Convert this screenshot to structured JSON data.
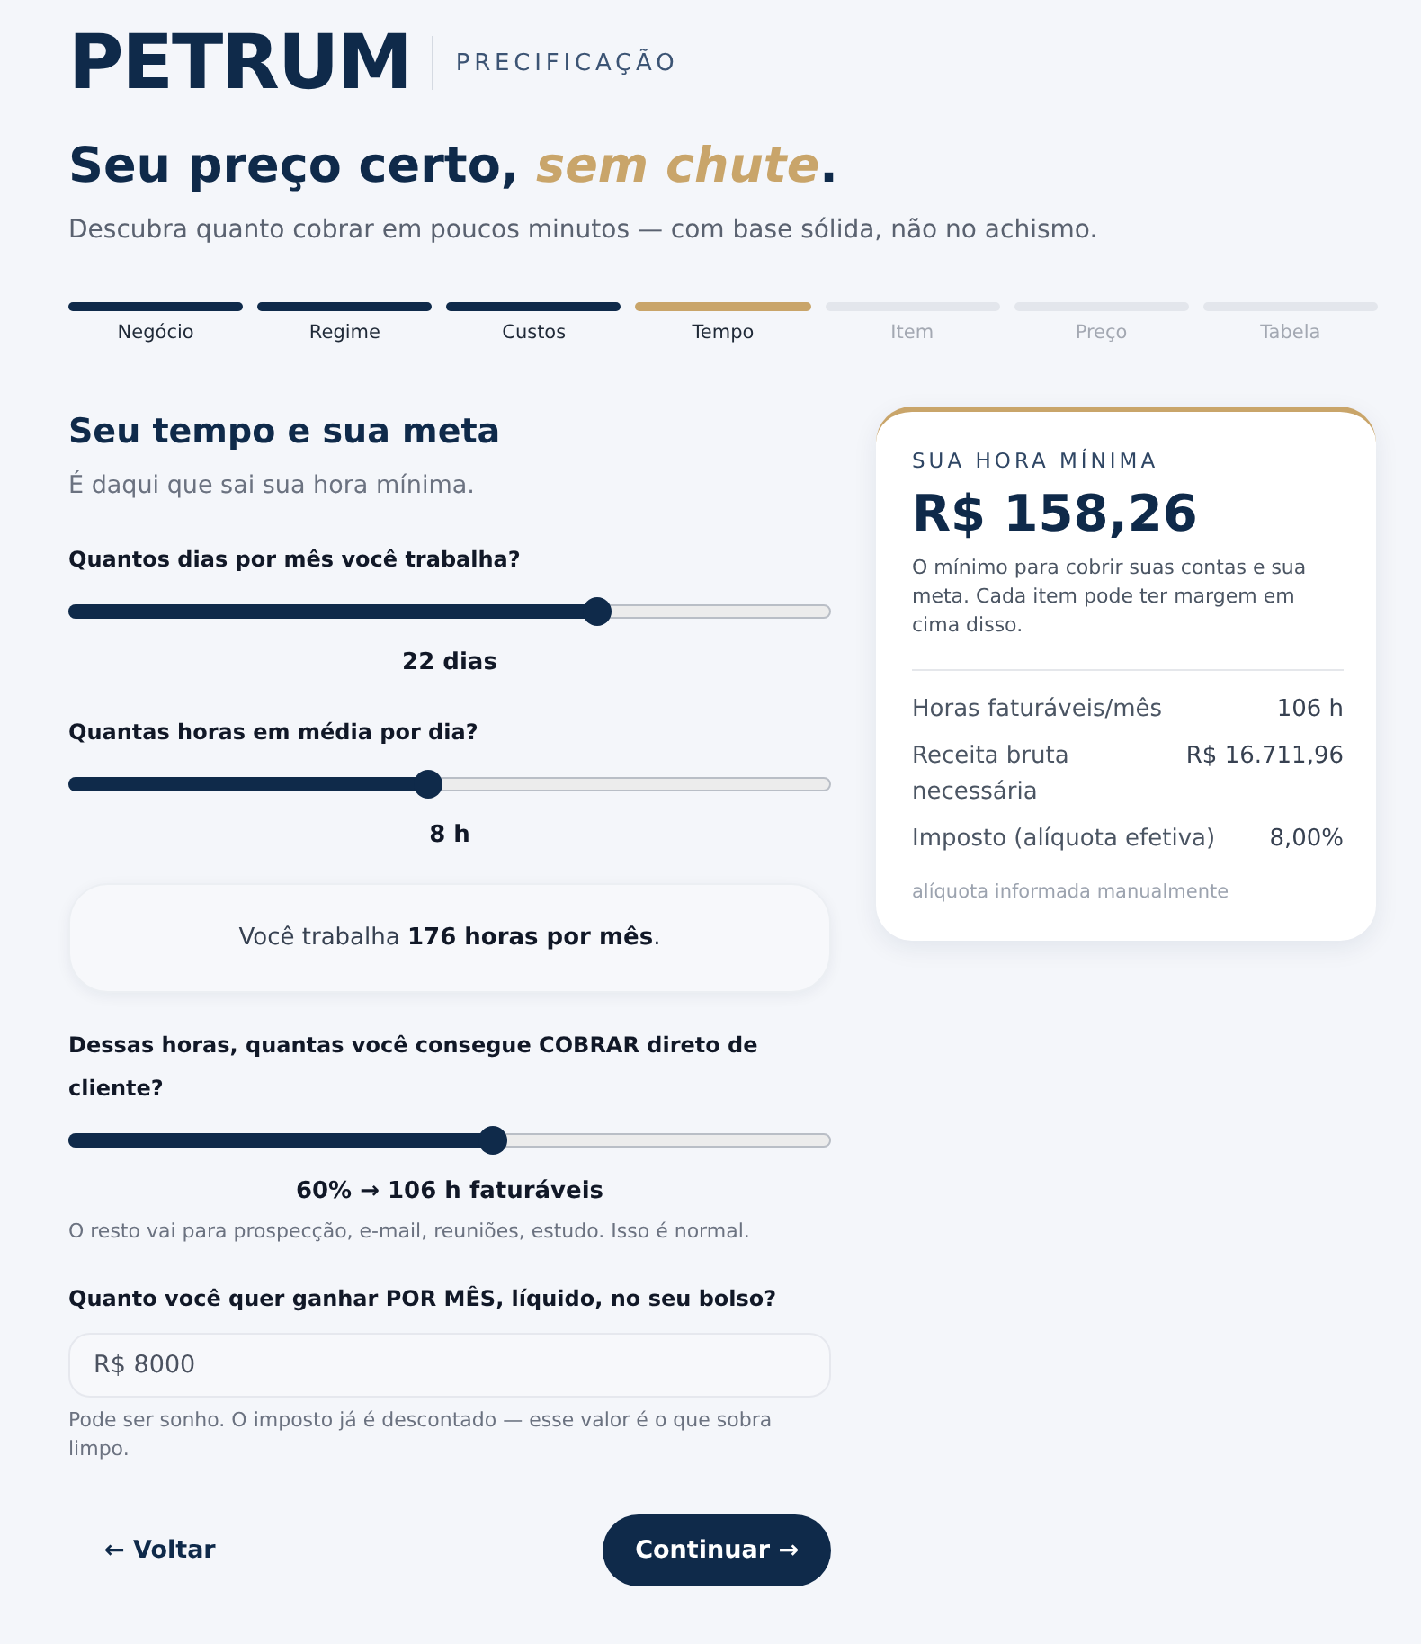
{
  "brand": {
    "logo": "PETRUM",
    "section": "PRECIFICAÇÃO"
  },
  "hero": {
    "title": "Seu preço certo, *sem chute*.",
    "subtitle": "Descubra quanto cobrar em poucos minutos — com base sólida, não no achismo."
  },
  "steps": [
    {
      "label": "Negócio",
      "done": true,
      "selected": false
    },
    {
      "label": "Regime",
      "done": true,
      "selected": false
    },
    {
      "label": "Custos",
      "done": true,
      "selected": false
    },
    {
      "label": "Tempo",
      "done": false,
      "selected": true
    },
    {
      "label": "Item",
      "done": false,
      "selected": false
    },
    {
      "label": "Preço",
      "done": false,
      "selected": false
    },
    {
      "label": "Tabela",
      "done": false,
      "selected": false
    }
  ],
  "form": {
    "title": "Seu tempo e sua meta",
    "subtitle": "É daqui que sai sua hora mínima.",
    "fields": [
      {
        "kind": "slider",
        "label": "Quantos dias por mês você trabalha?",
        "level": 0.7,
        "reading": "22 dias"
      },
      {
        "kind": "slider",
        "label": "Quantas horas em média por dia?",
        "level": 0.47,
        "reading": "8 h"
      },
      {
        "kind": "summary",
        "text": "Você trabalha **176 horas por mês**."
      },
      {
        "kind": "slider",
        "label": "Dessas horas, quantas você consegue COBRAR direto de cliente?",
        "level": 0.56,
        "reading": "60% → 106 h faturáveis",
        "hint": "O resto vai para prospecção, e-mail, reuniões, estudo. Isso é normal."
      },
      {
        "kind": "input",
        "label": "Quanto você quer ganhar POR MÊS, líquido, no seu bolso?",
        "value": "R$ 8000",
        "hint": "Pode ser sonho. O imposto já é descontado — esse valor é o que sobra limpo."
      }
    ]
  },
  "actions": {
    "back": "← Voltar",
    "next": "Continuar →"
  },
  "result": {
    "eyebrow": "SUA HORA MÍNIMA",
    "amount": "R$ 158,26",
    "description": "O mínimo para cobrir suas contas e sua meta. Cada item pode ter margem em cima disso.",
    "rows": [
      {
        "label": "Horas faturáveis/mês",
        "value": "106 h"
      },
      {
        "label": "Receita bruta necessária",
        "value": "R$ 16.711,96"
      },
      {
        "label": "Imposto (alíquota efetiva)",
        "value": "8,00%"
      }
    ],
    "note": "alíquota informada manualmente"
  }
}
